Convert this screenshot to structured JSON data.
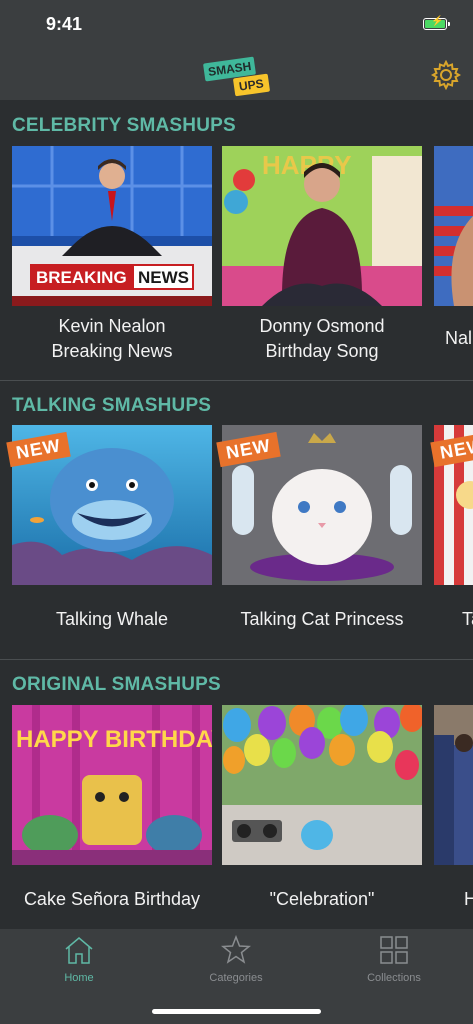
{
  "status": {
    "time": "9:41"
  },
  "app": {
    "logo_top": "SMASH",
    "logo_bottom": "UPS"
  },
  "sections": [
    {
      "title": "CELEBRITY SMASHUPS",
      "cards": [
        {
          "caption_line1": "Kevin Nealon",
          "caption_line2": "Breaking News",
          "banner_left": "BREAKING",
          "banner_right": "NEWS"
        },
        {
          "caption_line1": "Donny Osmond",
          "caption_line2": "Birthday Song",
          "banner_left": "HAPPY",
          "banner_right": ""
        },
        {
          "caption_line1": "Nal",
          "caption_line2": ""
        }
      ]
    },
    {
      "title": "TALKING SMASHUPS",
      "cards": [
        {
          "caption": "Talking Whale",
          "badge": "NEW"
        },
        {
          "caption": "Talking Cat Princess",
          "badge": "NEW"
        },
        {
          "caption": "Ta",
          "badge": "NEW"
        }
      ]
    },
    {
      "title": "ORIGINAL SMASHUPS",
      "cards": [
        {
          "caption": "Cake Señora Birthday",
          "overlay": "HAPPY BIRTHDAY!"
        },
        {
          "caption": "\"Celebration\""
        },
        {
          "caption": "H"
        }
      ]
    }
  ],
  "tabs": [
    {
      "label": "Home",
      "active": true
    },
    {
      "label": "Categories",
      "active": false
    },
    {
      "label": "Collections",
      "active": false
    }
  ],
  "colors": {
    "accent": "#5fb9a6",
    "badge": "#e8722b",
    "background": "#2b2e30",
    "bar": "#3b3e40"
  }
}
